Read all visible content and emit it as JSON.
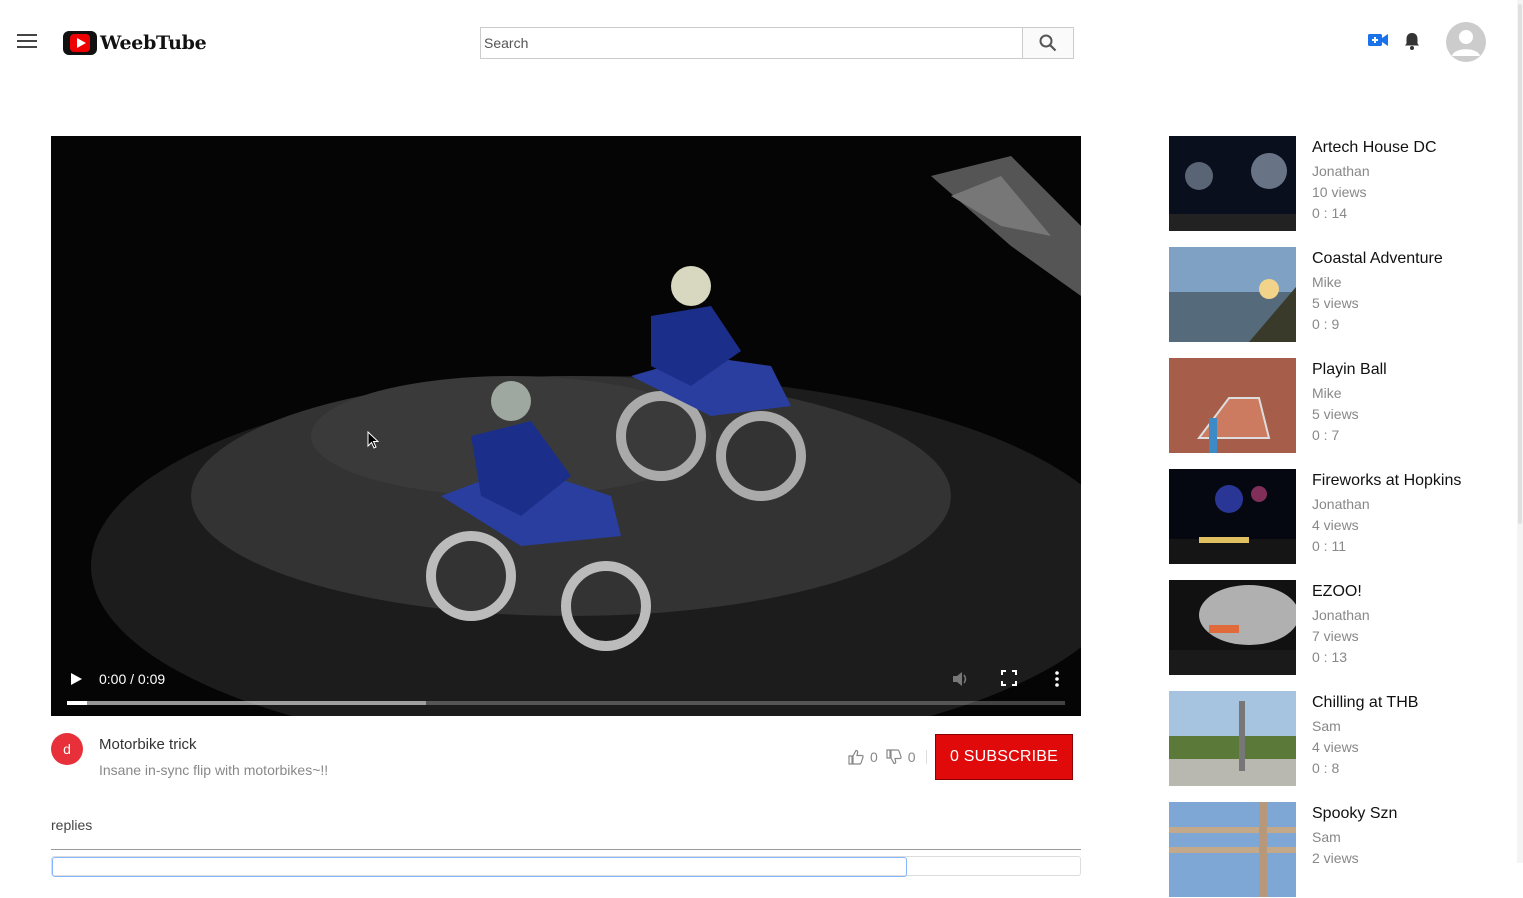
{
  "header": {
    "brand": "WeebTube",
    "search_placeholder": "Search"
  },
  "video": {
    "time_display": "0:00 / 0:09",
    "played_fraction": 0.02,
    "buffered_fraction": 0.36,
    "title": "Motorbike trick",
    "description": "Insane in-sync flip with motorbikes~!!",
    "channel_initial": "d",
    "likes": "0",
    "dislikes": "0",
    "subscribe_label": "0 SUBSCRIBE"
  },
  "replies_label": "replies",
  "sidebar": {
    "items": [
      {
        "title": "Artech House DC",
        "author": "Jonathan",
        "views": "10 views",
        "duration": "0 : 14",
        "thumb": "night"
      },
      {
        "title": "Coastal Adventure",
        "author": "Mike",
        "views": "5 views",
        "duration": "0 : 9",
        "thumb": "coast"
      },
      {
        "title": "Playin Ball",
        "author": "Mike",
        "views": "5 views",
        "duration": "0 : 7",
        "thumb": "court"
      },
      {
        "title": "Fireworks at Hopkins",
        "author": "Jonathan",
        "views": "4 views",
        "duration": "0 : 11",
        "thumb": "fireworks"
      },
      {
        "title": "EZOO!",
        "author": "Jonathan",
        "views": "7 views",
        "duration": "0 : 13",
        "thumb": "stage"
      },
      {
        "title": "Chilling at THB",
        "author": "Sam",
        "views": "4 views",
        "duration": "0 : 8",
        "thumb": "park"
      },
      {
        "title": "Spooky Szn",
        "author": "Sam",
        "views": "2 views",
        "duration": "",
        "thumb": "fence"
      }
    ]
  },
  "colors": {
    "subscribe": "#e10a0a",
    "channel_avatar": "#e8303a",
    "upload_icon": "#1a73e8"
  }
}
